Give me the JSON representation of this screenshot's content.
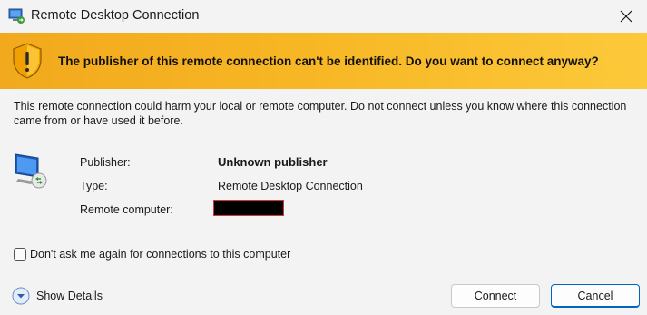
{
  "window": {
    "title": "Remote Desktop Connection",
    "close_icon": "close-icon",
    "app_icon": "remote-desktop-icon"
  },
  "banner": {
    "icon": "warning-shield-icon",
    "message": "The publisher of this remote connection can't be identified. Do you want to connect anyway?",
    "color": "#f7b624"
  },
  "body": {
    "warning": "This remote connection could harm your local or remote computer. Do not connect unless you know where this connection came from or have used it before.",
    "fields": {
      "publisher_label": "Publisher:",
      "publisher_value": "Unknown publisher",
      "type_label": "Type:",
      "type_value": "Remote Desktop Connection",
      "remote_label": "Remote computer:"
    },
    "dont_ask_label": "Don't ask me again for connections to this computer",
    "dont_ask_checked": false
  },
  "footer": {
    "show_details_label": "Show Details",
    "connect_label": "Connect",
    "cancel_label": "Cancel",
    "accent": "#0067c0"
  }
}
